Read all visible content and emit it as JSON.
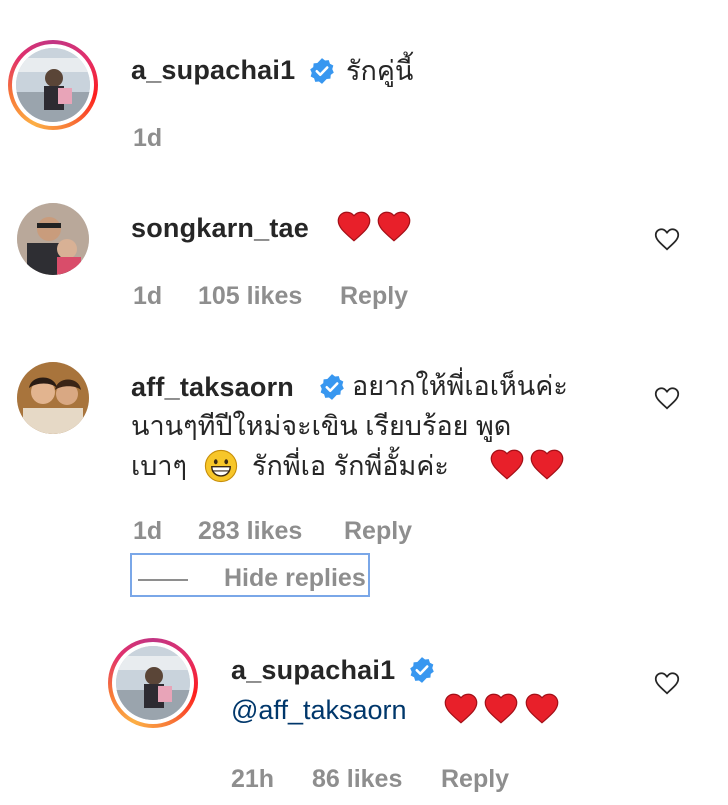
{
  "comments": [
    {
      "username": "a_supachai1",
      "text": "รักคู่นี้",
      "time": "1d"
    },
    {
      "username": "songkarn_tae",
      "time": "1d",
      "likes": "105 likes",
      "reply": "Reply"
    },
    {
      "username": "aff_taksaorn",
      "lines": [
        "อยากให้พี่เอเห็นค่ะ",
        "นานๆทีปีใหม่จะเขิน เรียบร้อย พูด",
        "เบาๆ",
        "รักพี่เอ รักพี่อั้มค่ะ"
      ],
      "time": "1d",
      "likes": "283 likes",
      "reply": "Reply",
      "hide_replies": "Hide replies"
    }
  ],
  "reply": {
    "username": "a_supachai1",
    "mention": "@aff_taksaorn",
    "time": "21h",
    "likes": "86 likes",
    "reply": "Reply"
  },
  "icons": {
    "verified": "verified-badge-icon",
    "heart_outline": "heart-outline-icon",
    "red_heart": "red-heart-emoji",
    "grin": "grinning-face-emoji"
  },
  "colors": {
    "verified_blue": "#3897f0",
    "heart_red": "#e8202a",
    "meta_gray": "#8e8e8e",
    "mention_blue": "#00376b"
  }
}
